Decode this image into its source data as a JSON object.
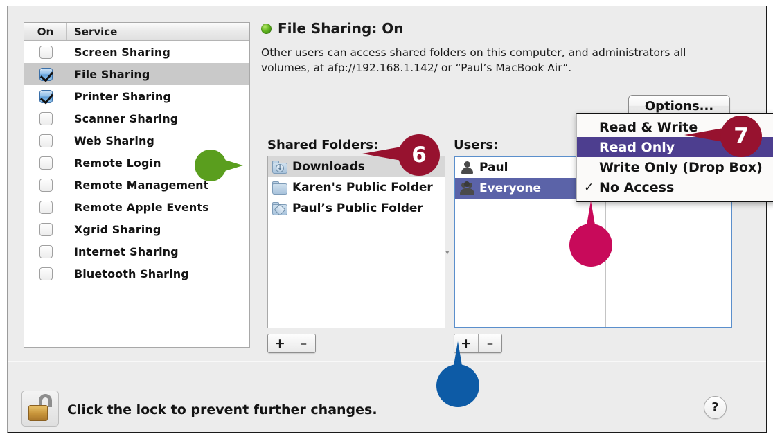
{
  "services_table": {
    "columns": [
      "On",
      "Service"
    ],
    "rows": [
      {
        "name": "Screen Sharing",
        "checked": false,
        "selected": false
      },
      {
        "name": "File Sharing",
        "checked": true,
        "selected": true
      },
      {
        "name": "Printer Sharing",
        "checked": true,
        "selected": false
      },
      {
        "name": "Scanner Sharing",
        "checked": false,
        "selected": false
      },
      {
        "name": "Web Sharing",
        "checked": false,
        "selected": false
      },
      {
        "name": "Remote Login",
        "checked": false,
        "selected": false
      },
      {
        "name": "Remote Management",
        "checked": false,
        "selected": false
      },
      {
        "name": "Remote Apple Events",
        "checked": false,
        "selected": false
      },
      {
        "name": "Xgrid Sharing",
        "checked": false,
        "selected": false
      },
      {
        "name": "Internet Sharing",
        "checked": false,
        "selected": false
      },
      {
        "name": "Bluetooth Sharing",
        "checked": false,
        "selected": false
      }
    ]
  },
  "detail": {
    "status_title": "File Sharing: On",
    "status_indicator": "green-led-icon",
    "description": "Other users can access shared folders on this computer, and administrators all volumes, at afp://192.168.1.142/ or “Paul’s MacBook Air”.",
    "options_button": "Options...",
    "shared_folders_label": "Shared Folders:",
    "users_label": "Users:",
    "shared_folders": [
      {
        "name": "Downloads",
        "icon": "downloads-folder-icon",
        "selected": true
      },
      {
        "name": "Karen's Public Folder",
        "icon": "folder-icon",
        "selected": false
      },
      {
        "name": "Paul’s Public Folder",
        "icon": "public-folder-icon",
        "selected": false
      }
    ],
    "users": [
      {
        "name": "Paul",
        "icon": "user-icon",
        "selected": false
      },
      {
        "name": "Everyone",
        "icon": "group-icon",
        "selected": true
      }
    ],
    "add_label": "+",
    "remove_label": "–"
  },
  "permission_menu": {
    "items": [
      {
        "label": "Read & Write",
        "checked": false,
        "highlighted": false
      },
      {
        "label": "Read Only",
        "checked": false,
        "highlighted": true
      },
      {
        "label": "Write Only (Drop Box)",
        "checked": false,
        "highlighted": false
      },
      {
        "label": "No Access",
        "checked": true,
        "highlighted": false
      }
    ],
    "check_glyph": "✓"
  },
  "footer": {
    "lock_icon": "open-padlock-icon",
    "lock_text": "Click the lock to prevent further changes.",
    "help_label": "?"
  },
  "callouts": [
    {
      "id": "green",
      "label": "",
      "color": "#5a9e1e",
      "points_to": "downloads-folder-icon"
    },
    {
      "id": "six",
      "label": "6",
      "color": "#97122f",
      "points_to": "shared-folder-downloads"
    },
    {
      "id": "seven",
      "label": "7",
      "color": "#97122f",
      "points_to": "menu-item-read-only"
    },
    {
      "id": "pink",
      "label": "",
      "color": "#c80a5a",
      "points_to": "menu-item-no-access-check"
    },
    {
      "id": "blue",
      "label": "",
      "color": "#0d5ba6",
      "points_to": "users-add-button"
    }
  ]
}
